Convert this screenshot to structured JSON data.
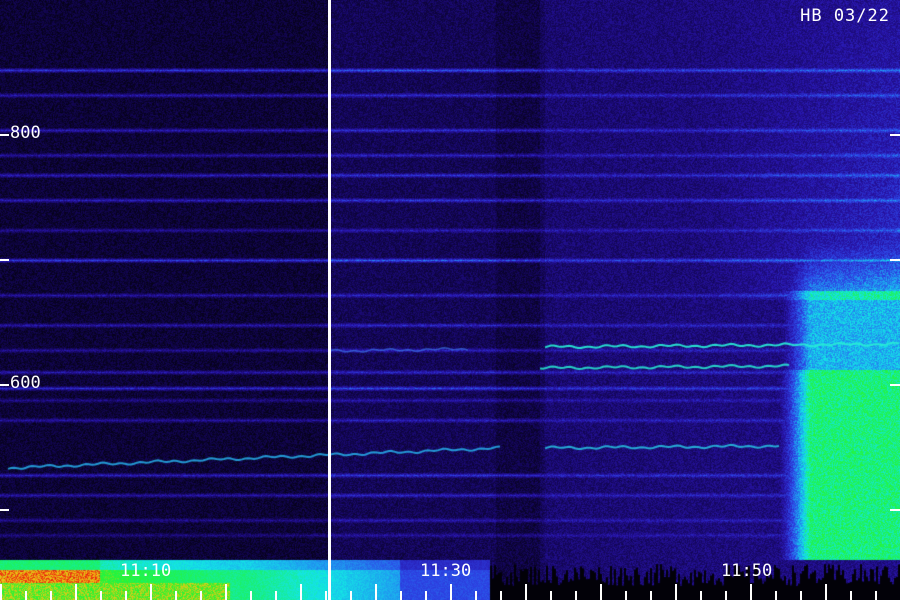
{
  "header": {
    "station": "HB 03/22"
  },
  "freq_axis": {
    "labels": [
      "800",
      "600"
    ]
  },
  "time_axis": {
    "labels": [
      "11:10",
      "11:30",
      "11:50"
    ]
  },
  "colors": {
    "background": "#05021a",
    "low": "#1a0a6a",
    "mid": "#2a3ad8",
    "high": "#19e6e6",
    "very_high": "#18f05a",
    "peak": "#e81818",
    "ticks": "#ffffff"
  }
}
